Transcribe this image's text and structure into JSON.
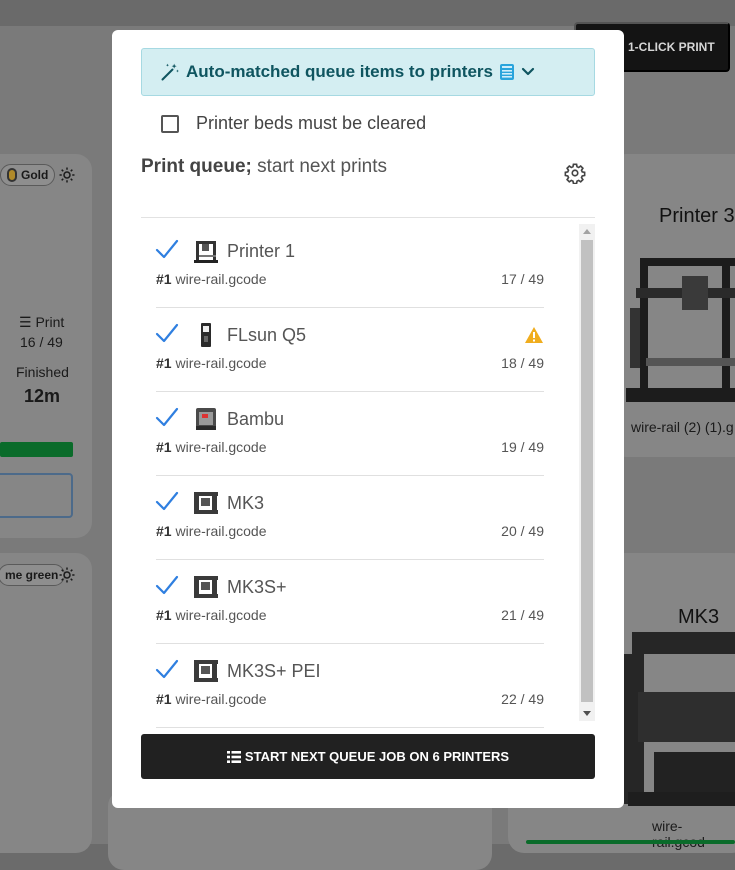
{
  "background": {
    "one_click_print": "1-CLICK PRINT",
    "left_card": {
      "filament_chip": "Gold",
      "print_label": "Print",
      "print_count": "16 / 49",
      "finished_label": "Finished",
      "finished_time": "12m"
    },
    "left_card_2": {
      "filament_chip": "me green"
    },
    "right_card": {
      "printer_name": "Printer 3",
      "file": "wire-rail (2) (1).g"
    },
    "right_card_2": {
      "printer_name": "MK3",
      "file": "wire-rail.gcod"
    }
  },
  "modal": {
    "banner_text": "Auto-matched queue items to printers",
    "checkbox_label": "Printer beds must be cleared",
    "checkbox_checked": false,
    "title_bold": "Print queue;",
    "title_rest": " start next prints",
    "items": [
      {
        "printer": "Printer 1",
        "job_index": "#1",
        "file": "wire-rail.gcode",
        "count": "17 / 49",
        "warning": false,
        "icon": "ender-printer-icon"
      },
      {
        "printer": "FLsun Q5",
        "job_index": "#1",
        "file": "wire-rail.gcode",
        "count": "18 / 49",
        "warning": true,
        "icon": "delta-printer-icon"
      },
      {
        "printer": "Bambu",
        "job_index": "#1",
        "file": "wire-rail.gcode",
        "count": "19 / 49",
        "warning": false,
        "icon": "bambu-printer-icon"
      },
      {
        "printer": "MK3",
        "job_index": "#1",
        "file": "wire-rail.gcode",
        "count": "20 / 49",
        "warning": false,
        "icon": "prusa-printer-icon"
      },
      {
        "printer": "MK3S+",
        "job_index": "#1",
        "file": "wire-rail.gcode",
        "count": "21 / 49",
        "warning": false,
        "icon": "prusa-printer-icon"
      },
      {
        "printer": "MK3S+ PEI",
        "job_index": "#1",
        "file": "wire-rail.gcode",
        "count": "22 / 49",
        "warning": false,
        "icon": "prusa-printer-icon"
      }
    ],
    "start_button": "START NEXT QUEUE JOB ON 6 PRINTERS"
  },
  "colors": {
    "banner_bg": "#d4eef2",
    "banner_text": "#0f5560",
    "check": "#2f7fe0",
    "warning": "#f0ad1e",
    "button_bg": "#212121"
  }
}
